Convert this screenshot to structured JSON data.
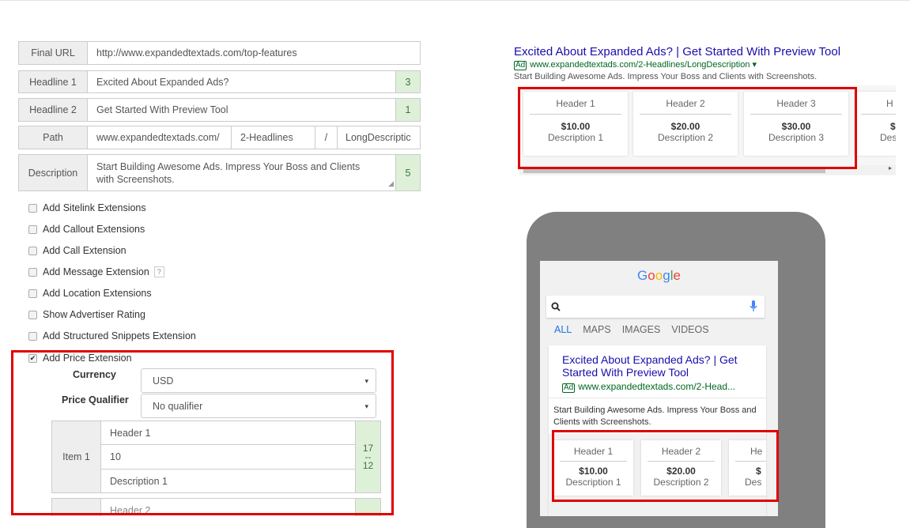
{
  "form": {
    "final_url": {
      "label": "Final URL",
      "value": "http://www.expandedtextads.com/top-features"
    },
    "headline1": {
      "label": "Headline 1",
      "value": "Excited About Expanded Ads?",
      "count": "3"
    },
    "headline2": {
      "label": "Headline 2",
      "value": "Get Started With Preview Tool",
      "count": "1"
    },
    "path": {
      "label": "Path",
      "base": "www.expandedtextads.com/",
      "path1": "2-Headlines",
      "sep": "/",
      "path2": "LongDescriptic"
    },
    "description": {
      "label": "Description",
      "value": "Start Building Awesome Ads. Impress Your Boss and Clients with Screenshots.",
      "count": "5"
    }
  },
  "extensions": [
    {
      "label": "Add Sitelink Extensions",
      "checked": false
    },
    {
      "label": "Add Callout Extensions",
      "checked": false
    },
    {
      "label": "Add Call Extension",
      "checked": false
    },
    {
      "label": "Add Message Extension",
      "checked": false,
      "help": "?"
    },
    {
      "label": "Add Location Extensions",
      "checked": false
    },
    {
      "label": "Show Advertiser Rating",
      "checked": false
    },
    {
      "label": "Add Structured Snippets Extension",
      "checked": false
    },
    {
      "label": "Add Price Extension",
      "checked": true,
      "mark": "✔"
    }
  ],
  "price": {
    "currency_label": "Currency",
    "currency_value": "USD",
    "qualifier_label": "Price Qualifier",
    "qualifier_value": "No qualifier",
    "arrow": "▾",
    "item1": {
      "label": "Item 1",
      "header": "Header 1",
      "price": "10",
      "description": "Description 1",
      "count_top": "17",
      "count_mid": "--",
      "count_bottom": "12"
    },
    "item2": {
      "header": "Header 2"
    }
  },
  "desktop_preview": {
    "title": "Excited About Expanded Ads? | Get Started With Preview Tool",
    "ad_badge": "Ad",
    "url": "www.expandedtextads.com/2-Headlines/LongDescription ▾",
    "description": "Start Building Awesome Ads. Impress Your Boss and Clients with Screenshots.",
    "cards": [
      {
        "header": "Header 1",
        "price": "$10.00",
        "description": "Description 1"
      },
      {
        "header": "Header 2",
        "price": "$20.00",
        "description": "Description 2"
      },
      {
        "header": "Header 3",
        "price": "$30.00",
        "description": "Description 3"
      },
      {
        "header": "H",
        "price": "$",
        "description": "Des"
      }
    ],
    "scroll_arrow": "▸"
  },
  "mobile_preview": {
    "google_letters": [
      {
        "ch": "G",
        "color": "#4285F4"
      },
      {
        "ch": "o",
        "color": "#EA4335"
      },
      {
        "ch": "o",
        "color": "#FBBC05"
      },
      {
        "ch": "g",
        "color": "#4285F4"
      },
      {
        "ch": "l",
        "color": "#34A853"
      },
      {
        "ch": "e",
        "color": "#EA4335"
      }
    ],
    "tabs": [
      "ALL",
      "MAPS",
      "IMAGES",
      "VIDEOS"
    ],
    "title": "Excited About Expanded Ads? | Get Started With Preview Tool",
    "ad_badge": "Ad",
    "url": "www.expandedtextads.com/2-Head...",
    "description": "Start Building Awesome Ads. Impress Your Boss and Clients with Screenshots.",
    "cards": [
      {
        "header": "Header 1",
        "price": "$10.00",
        "description": "Description 1"
      },
      {
        "header": "Header 2",
        "price": "$20.00",
        "description": "Description 2"
      },
      {
        "header": "He",
        "price": "$",
        "description": "Des"
      }
    ]
  },
  "colors": {
    "highlight": "#e00000",
    "counter_bg": "#dff0d8",
    "counter_text": "#3c763d",
    "link": "#1a0dab",
    "url_green": "#006621"
  }
}
